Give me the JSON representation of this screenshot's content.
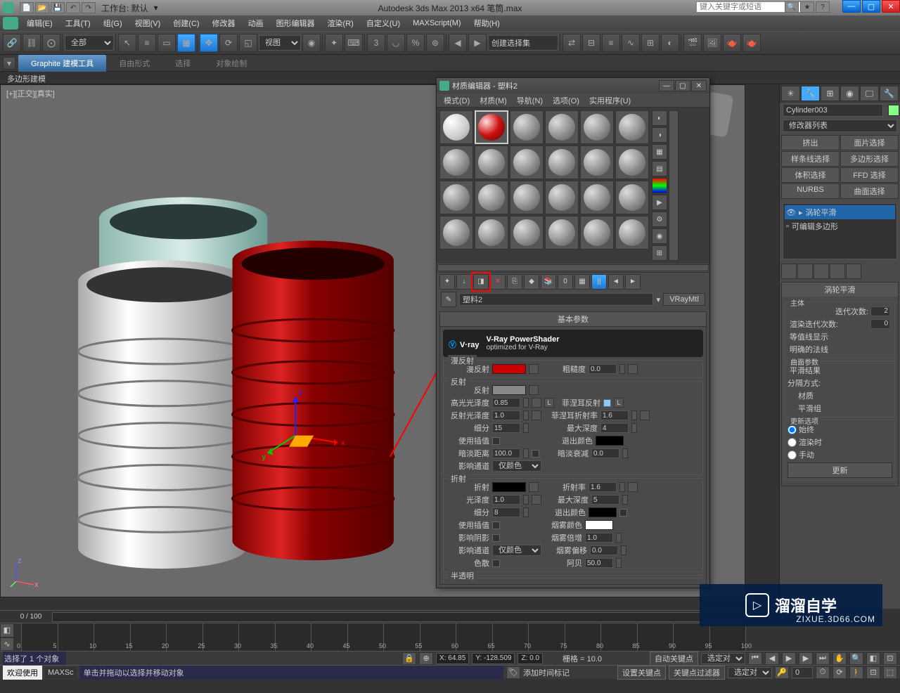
{
  "titlebar": {
    "workspace_label": "工作台: 默认",
    "app_title": "Autodesk 3ds Max  2013 x64    笔筒.max",
    "search_placeholder": "键入关键字或短语"
  },
  "menus": [
    "编辑(E)",
    "工具(T)",
    "组(G)",
    "视图(V)",
    "创建(C)",
    "修改器",
    "动画",
    "图形编辑器",
    "渲染(R)",
    "自定义(U)",
    "MAXScript(M)",
    "帮助(H)"
  ],
  "toolbar": {
    "filter": "全部",
    "viewport_label": "视图",
    "selection_set": "创建选择集"
  },
  "ribbon": {
    "tabs": [
      "Graphite 建模工具",
      "自由形式",
      "选择",
      "对象绘制"
    ],
    "sub": "多边形建模"
  },
  "viewport": {
    "label": "[+][正交][真实]"
  },
  "material_editor": {
    "title": "材质编辑器 - 塑料2",
    "menus": [
      "模式(D)",
      "材质(M)",
      "导航(N)",
      "选项(O)",
      "实用程序(U)"
    ],
    "material_name": "塑料2",
    "material_type": "VRayMtl",
    "rollout_basic": "基本参数",
    "vray": {
      "brand": "V·ray",
      "subtitle1": "V-Ray PowerShader",
      "subtitle2": "optimized for V-Ray"
    },
    "groups": {
      "diffuse": "漫反射",
      "reflection": "反射",
      "refraction": "折射",
      "translucency": "半透明"
    },
    "labels": {
      "diffuse": "漫反射",
      "roughness": "粗糙度",
      "reflect": "反射",
      "hilight_gloss": "高光光泽度",
      "refl_gloss": "反射光泽度",
      "subdivs": "细分",
      "use_interp": "使用插值",
      "dim_distance": "暗淡距离",
      "affect_channels": "影响通道",
      "fresnel": "菲涅耳反射",
      "fresnel_ior": "菲涅耳折射率",
      "max_depth": "最大深度",
      "exit_color": "退出颜色",
      "dim_falloff": "暗淡衰减",
      "refract": "折射",
      "glossiness": "光泽度",
      "ior": "折射率",
      "affect_shadows": "影响阴影",
      "fog_color": "烟雾颜色",
      "fog_mult": "烟雾倍增",
      "fog_bias": "烟雾偏移",
      "dispersion": "色散",
      "abbe": "阿贝",
      "only_reflection": "仅颜色"
    },
    "values": {
      "roughness": "0.0",
      "hilight_gloss": "0.85",
      "refl_gloss": "1.0",
      "subdivs": "15",
      "dim_distance": "100.0",
      "fresnel_ior": "1.6",
      "max_depth_r": "4",
      "dim_falloff": "0.0",
      "refr_gloss": "1.0",
      "refr_subdivs": "8",
      "ior": "1.6",
      "max_depth_f": "5",
      "fog_mult": "1.0",
      "fog_bias": "0.0",
      "abbe": "50.0",
      "channel_option": "仅颜色"
    }
  },
  "cmdpanel": {
    "object_name": "Cylinder003",
    "modifier_dropdown": "修改器列表",
    "mod_buttons": [
      "挤出",
      "面片选择",
      "样条线选择",
      "多边形选择",
      "体积选择",
      "FFD 选择",
      "NURBS",
      "曲面选择"
    ],
    "stack": [
      {
        "label": "涡轮平滑",
        "sel": true
      },
      {
        "label": "可编辑多边形",
        "sel": false
      }
    ],
    "rollup_turbosmooth": {
      "title": "涡轮平滑",
      "group_main": "主体",
      "iterations": "迭代次数:",
      "iterations_val": "2",
      "render_iters": "渲染迭代次数:",
      "render_iters_val": "0",
      "isoline": "等值线显示",
      "explicit": "明确的法线",
      "group_surface": "曲面参数",
      "smooth_result": "平滑结果",
      "sep_by": "分隔方式:",
      "materials": "材质",
      "smoothing_groups": "平滑组",
      "group_update": "更新选项",
      "always": "始终",
      "when_render": "渲染时",
      "manually": "手动",
      "update_btn": "更新"
    }
  },
  "timeline": {
    "frame": "0 / 100"
  },
  "trackbar_ticks": [
    "0",
    "5",
    "10",
    "15",
    "20",
    "25",
    "30",
    "35",
    "40",
    "45",
    "50",
    "55",
    "60",
    "65",
    "70",
    "75",
    "80",
    "85",
    "90",
    "95",
    "100"
  ],
  "status": {
    "welcome": "欢迎使用",
    "maxscript": "MAXSc",
    "selected": "选择了 1 个对象",
    "hint": "单击并拖动以选择并移动对象",
    "x": "X: 64.85",
    "y": "Y: -128.509",
    "z": "Z: 0.0",
    "grid": "栅格 = 10.0",
    "add_time_tag": "添加时间标记",
    "auto_key": "自动关键点",
    "set_key": "设置关键点",
    "selected_key": "选定对",
    "key_filter": "关键点过滤器",
    "key_filter2": "选定对"
  },
  "watermark": {
    "text": "溜溜自学",
    "sub": "ZIXUE.3D66.COM"
  }
}
